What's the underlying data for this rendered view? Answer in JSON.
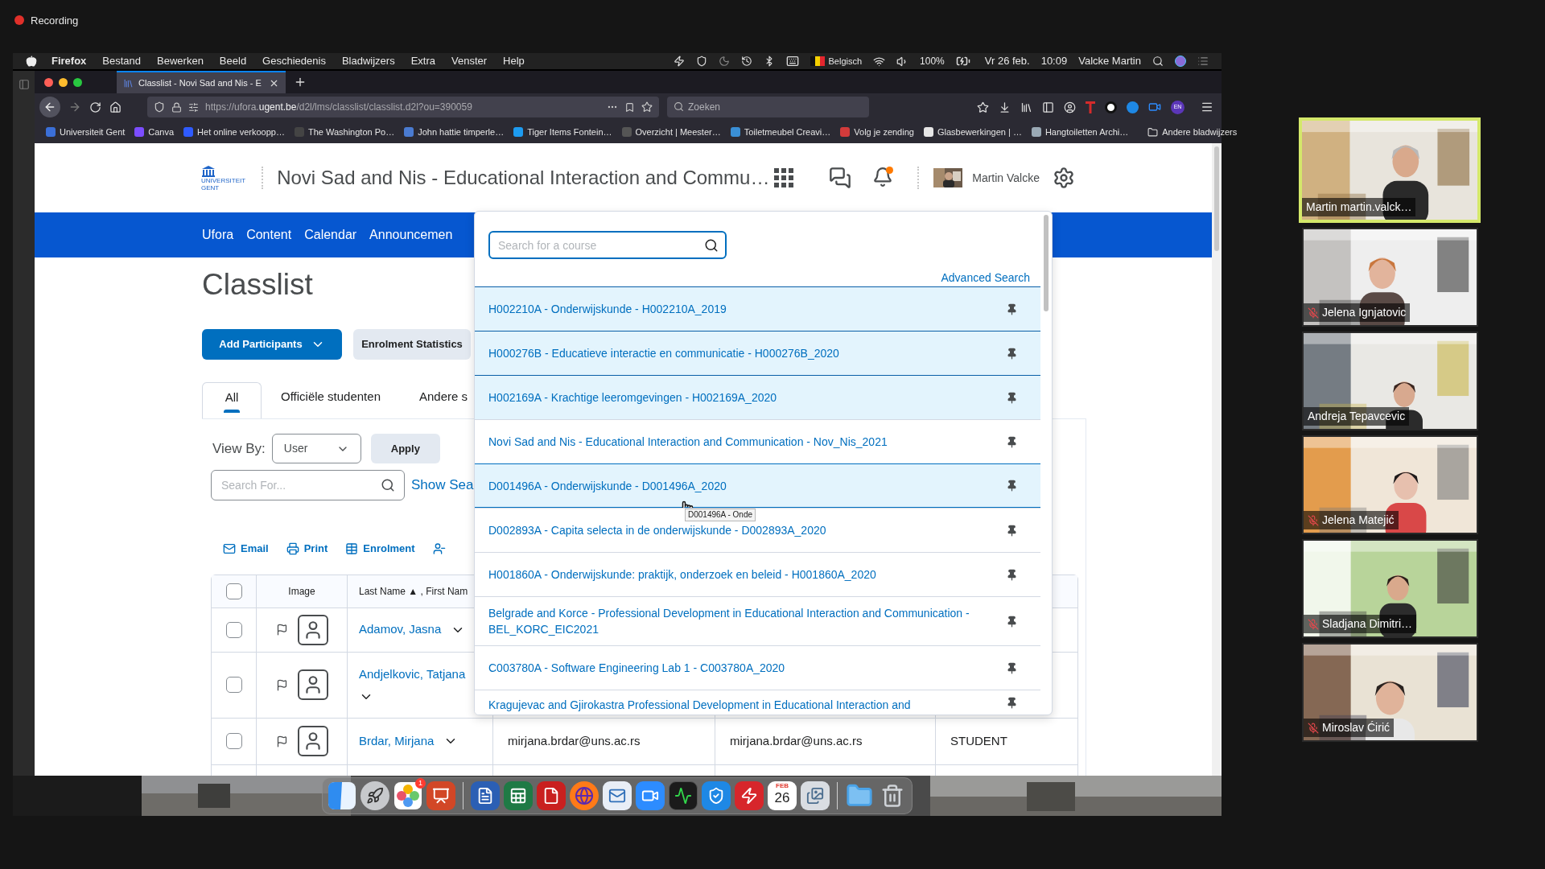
{
  "recording": {
    "label": "Recording"
  },
  "menu_bar": {
    "app": "Firefox",
    "items": [
      "Bestand",
      "Bewerken",
      "Beeld",
      "Geschiedenis",
      "Bladwijzers",
      "Extra",
      "Venster",
      "Help"
    ],
    "keyboard_layout": "Belgisch",
    "battery": "100%",
    "date": "Vr 26 feb.",
    "time": "10:09",
    "user": "Valcke Martin"
  },
  "browser": {
    "tab": {
      "title": "Classlist - Novi Sad and Nis - E",
      "selected": true
    },
    "url": "https://ufora.**ugent.be**/d2l/lms/classlist/classlist.d2l?ou=390059",
    "search": {
      "placeholder": "Zoeken"
    },
    "extension_badge": "EN",
    "bookmarks": [
      "Universiteit Gent",
      "Canva",
      "Het online verkoopp…",
      "The Washington Po…",
      "John hattie timperle…",
      "Tiger Items Fontein…",
      "Overzicht | Meester…",
      "Toiletmeubel Creavi…",
      "Volg je zending",
      "Glasbewerkingen | …",
      "Hangtoiletten Archi…"
    ],
    "other_bookmarks": "Andere bladwijzers"
  },
  "page": {
    "logo": {
      "line1": "UNIVERSITEIT",
      "line2": "GENT"
    },
    "course_title": "Novi Sad and Nis - Educational Interaction and Commu…",
    "notification_unread": true,
    "user_name": "Martin Valcke",
    "nav": [
      "Ufora",
      "Content",
      "Calendar",
      "Announcemen"
    ],
    "heading": "Classlist",
    "add_participants": "Add Participants",
    "enrolment_statistics": "Enrolment Statistics",
    "tabs": [
      {
        "label": "All",
        "selected": true
      },
      {
        "label": "Officiële studenten",
        "selected": false
      },
      {
        "label": "Andere s",
        "selected": false
      }
    ],
    "view_by": {
      "label": "View By:",
      "value": "User",
      "apply": "Apply"
    },
    "search": {
      "placeholder": "Search For...",
      "show_search_options": "Show Sea"
    },
    "actions": [
      "Email",
      "Print",
      "Enrolment"
    ],
    "table": {
      "header_checked": false,
      "columns": [
        "Image",
        "Last Name ▲ , First Nam"
      ],
      "rows": [
        {
          "name": "Adamov, Jasna",
          "checked": false
        },
        {
          "name": "Andjelkovic, Tatjana",
          "checked": false
        },
        {
          "name": "Brdar, Mirjana",
          "checked": false,
          "email": "mirjana.brdar@uns.ac.rs",
          "username": "mirjana.brdar@uns.ac.rs",
          "role": "STUDENT"
        }
      ]
    }
  },
  "course_menu": {
    "search": {
      "placeholder": "Search for a course"
    },
    "advanced_search": "Advanced Search",
    "courses": [
      {
        "name": "H002210A - Onderwijskunde - H002210A_2019",
        "highlighted": true,
        "hovered": false
      },
      {
        "name": "H000276B - Educatieve interactie en communicatie - H000276B_2020",
        "highlighted": true,
        "hovered": false
      },
      {
        "name": "H002169A - Krachtige leeromgevingen - H002169A_2020",
        "highlighted": true,
        "hovered": false
      },
      {
        "name": "Novi Sad and Nis - Educational Interaction and Communication - Nov_Nis_2021",
        "highlighted": false,
        "hovered": false
      },
      {
        "name": "D001496A - Onderwijskunde - D001496A_2020",
        "highlighted": true,
        "hovered": true
      },
      {
        "name": "D002893A - Capita selecta in de onderwijskunde - D002893A_2020",
        "highlighted": false,
        "hovered": false
      },
      {
        "name": "H001860A - Onderwijskunde: praktijk, onderzoek en beleid - H001860A_2020",
        "highlighted": false,
        "hovered": false
      },
      {
        "name": "Belgrade and Korce - Professional Development in Educational Interaction and Communication - BEL_KORC_EIC2021",
        "highlighted": false,
        "hovered": false
      },
      {
        "name": "C003780A - Software Engineering Lab 1 - C003780A_2020",
        "highlighted": false,
        "hovered": false
      },
      {
        "name": "Kragujevac and Gjirokastra Professional Development in Educational Interaction and",
        "highlighted": false,
        "hovered": false
      }
    ],
    "tooltip": "D001496A - Onde"
  },
  "dock": {
    "photos_badge": "1",
    "calendar_month": "FEB",
    "calendar_day": "26"
  },
  "participants": [
    {
      "name": "Martin martin.valck…",
      "muted": false,
      "speaking": true
    },
    {
      "name": "Jelena Ignjatovic",
      "muted": true,
      "speaking": false
    },
    {
      "name": "Andreja Tepavcevic",
      "muted": false,
      "speaking": false
    },
    {
      "name": "Jelena Matejić",
      "muted": true,
      "speaking": false
    },
    {
      "name": "Sladjana Dimitri…",
      "muted": true,
      "speaking": false
    },
    {
      "name": "Miroslav Ćirić",
      "muted": true,
      "speaking": false
    }
  ]
}
